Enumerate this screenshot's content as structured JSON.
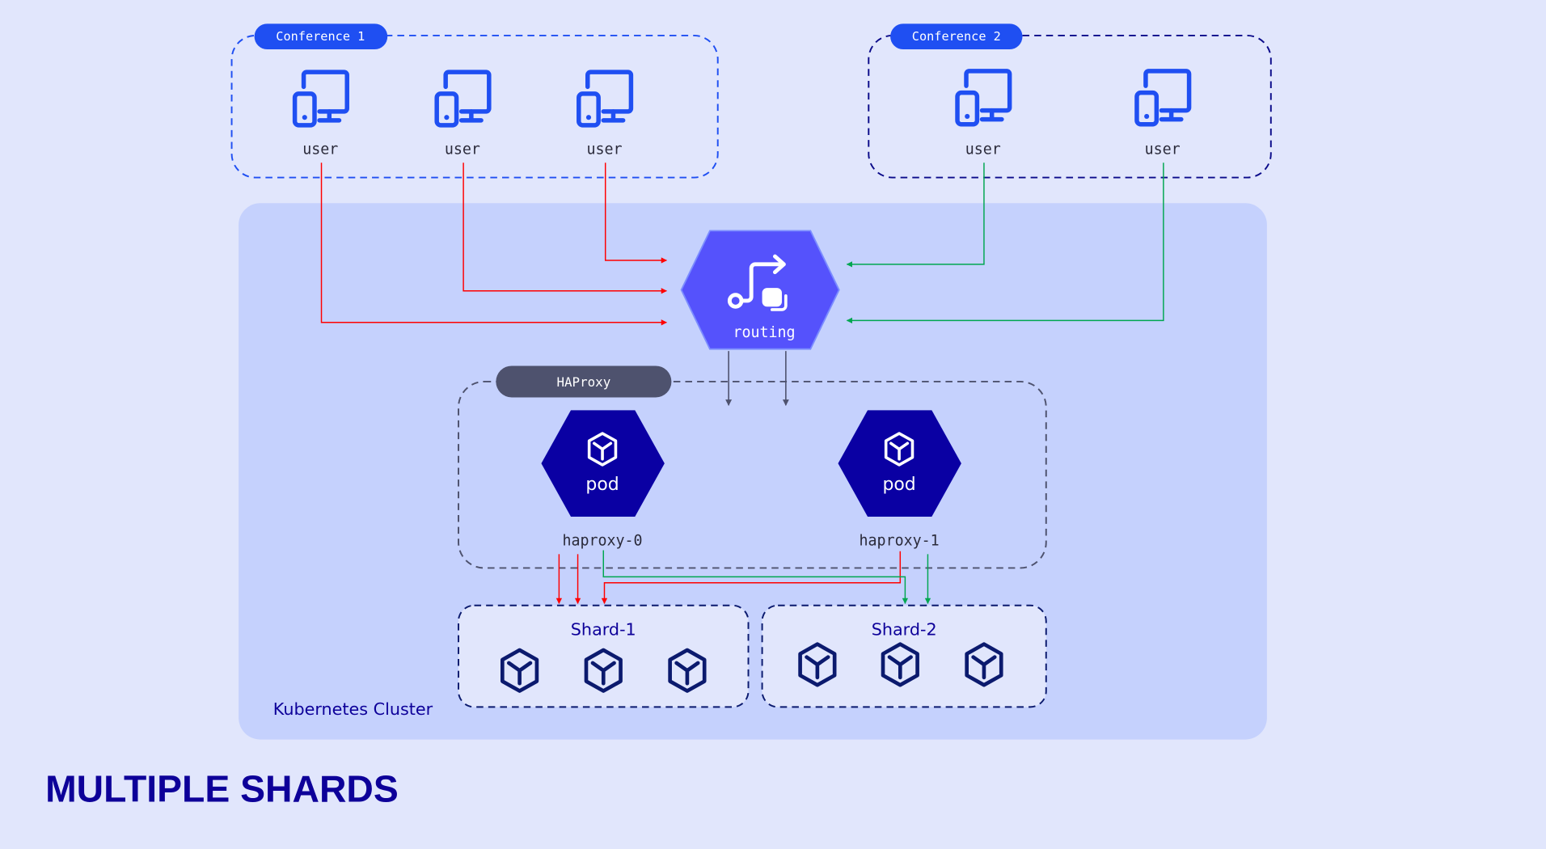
{
  "title": "MULTIPLE SHARDS",
  "cluster": {
    "label": "Kubernetes Cluster"
  },
  "conferences": [
    {
      "label": "Conference 1",
      "users": [
        "user",
        "user",
        "user"
      ],
      "color": "#1f4ff2"
    },
    {
      "label": "Conference 2",
      "users": [
        "user",
        "user"
      ],
      "color": "#0b0b8a"
    }
  ],
  "routing": {
    "label": "routing",
    "icon": "route-icon"
  },
  "haproxy": {
    "label": "HAProxy",
    "pods": [
      {
        "label": "pod",
        "name": "haproxy-0"
      },
      {
        "label": "pod",
        "name": "haproxy-1"
      }
    ]
  },
  "shards": [
    {
      "label": "Shard-1",
      "nodes": 3
    },
    {
      "label": "Shard-2",
      "nodes": 3
    }
  ],
  "colors": {
    "background": "#e1e6fc",
    "cluster": "#c5d1fd",
    "routing": "#5552fc",
    "pod": "#0a00a3",
    "conference_pill": "#1f4ff2",
    "haproxy_pill": "#4e526e",
    "conf1_flow": "#ff0000",
    "conf2_flow": "#00a650",
    "title": "#0d0099"
  }
}
